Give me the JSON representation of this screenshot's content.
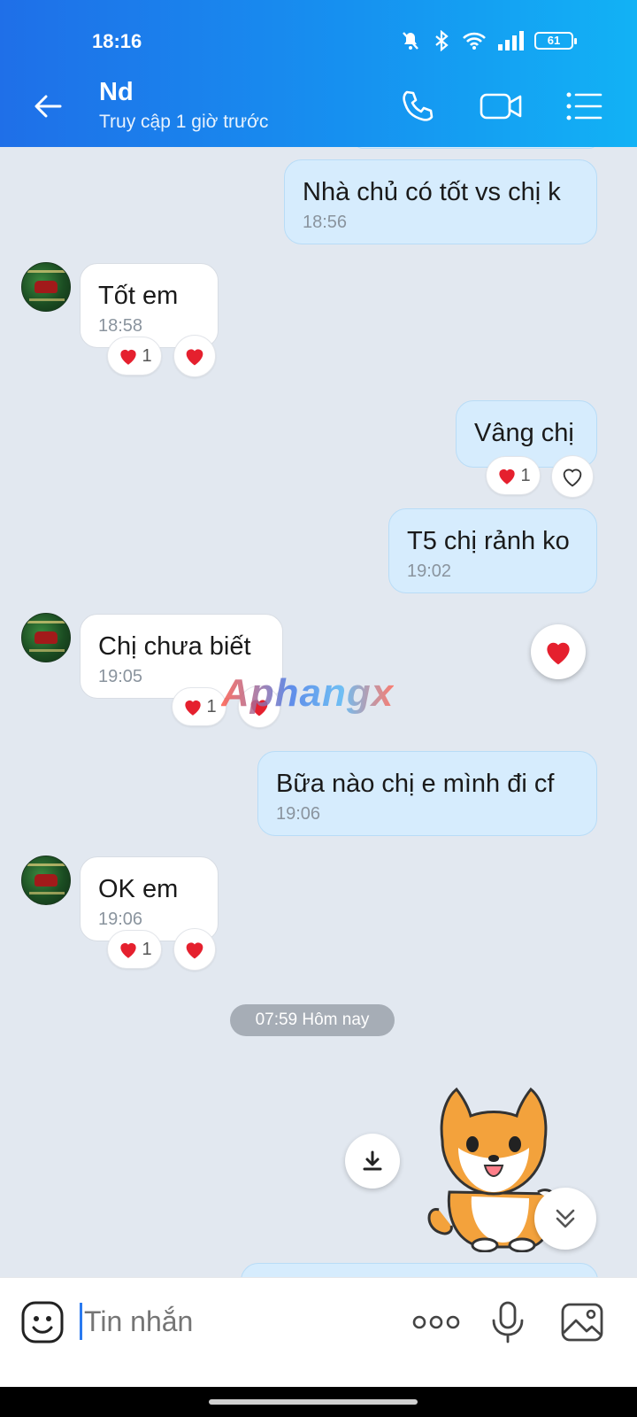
{
  "status_bar": {
    "time": "18:16",
    "battery": "61"
  },
  "header": {
    "contact_name": "Nd",
    "last_seen": "Truy cập 1 giờ trước"
  },
  "messages": [
    {
      "direction": "out",
      "text": "Nhà chủ có tốt vs chị k",
      "time": "18:56"
    },
    {
      "direction": "in",
      "text": "Tốt em",
      "time": "18:58",
      "reaction_count": "1"
    },
    {
      "direction": "out",
      "text": "Vâng chị",
      "reaction_count": "1"
    },
    {
      "direction": "out",
      "text": "T5 chị rảnh ko",
      "time": "19:02"
    },
    {
      "direction": "in",
      "text": "Chị chưa biết",
      "time": "19:05",
      "reaction_count": "1"
    },
    {
      "direction": "out",
      "text": "Bữa nào chị e mình đi cf",
      "time": "19:06"
    },
    {
      "direction": "in",
      "text": "OK em",
      "time": "19:06",
      "reaction_count": "1"
    }
  ],
  "watermark": "Aphangx",
  "date_separator": "07:59 Hôm nay",
  "input": {
    "placeholder": "Tin nhắn"
  },
  "colors": {
    "accent": "#1f6fe8",
    "heart": "#e5202e",
    "outgoing_bubble": "#d6ecfd"
  },
  "icons": [
    "back-arrow-icon",
    "phone-icon",
    "video-call-icon",
    "menu-icon",
    "emoji-icon",
    "more-icon",
    "mic-icon",
    "image-icon",
    "download-icon",
    "scroll-down-icon",
    "heart-icon"
  ]
}
